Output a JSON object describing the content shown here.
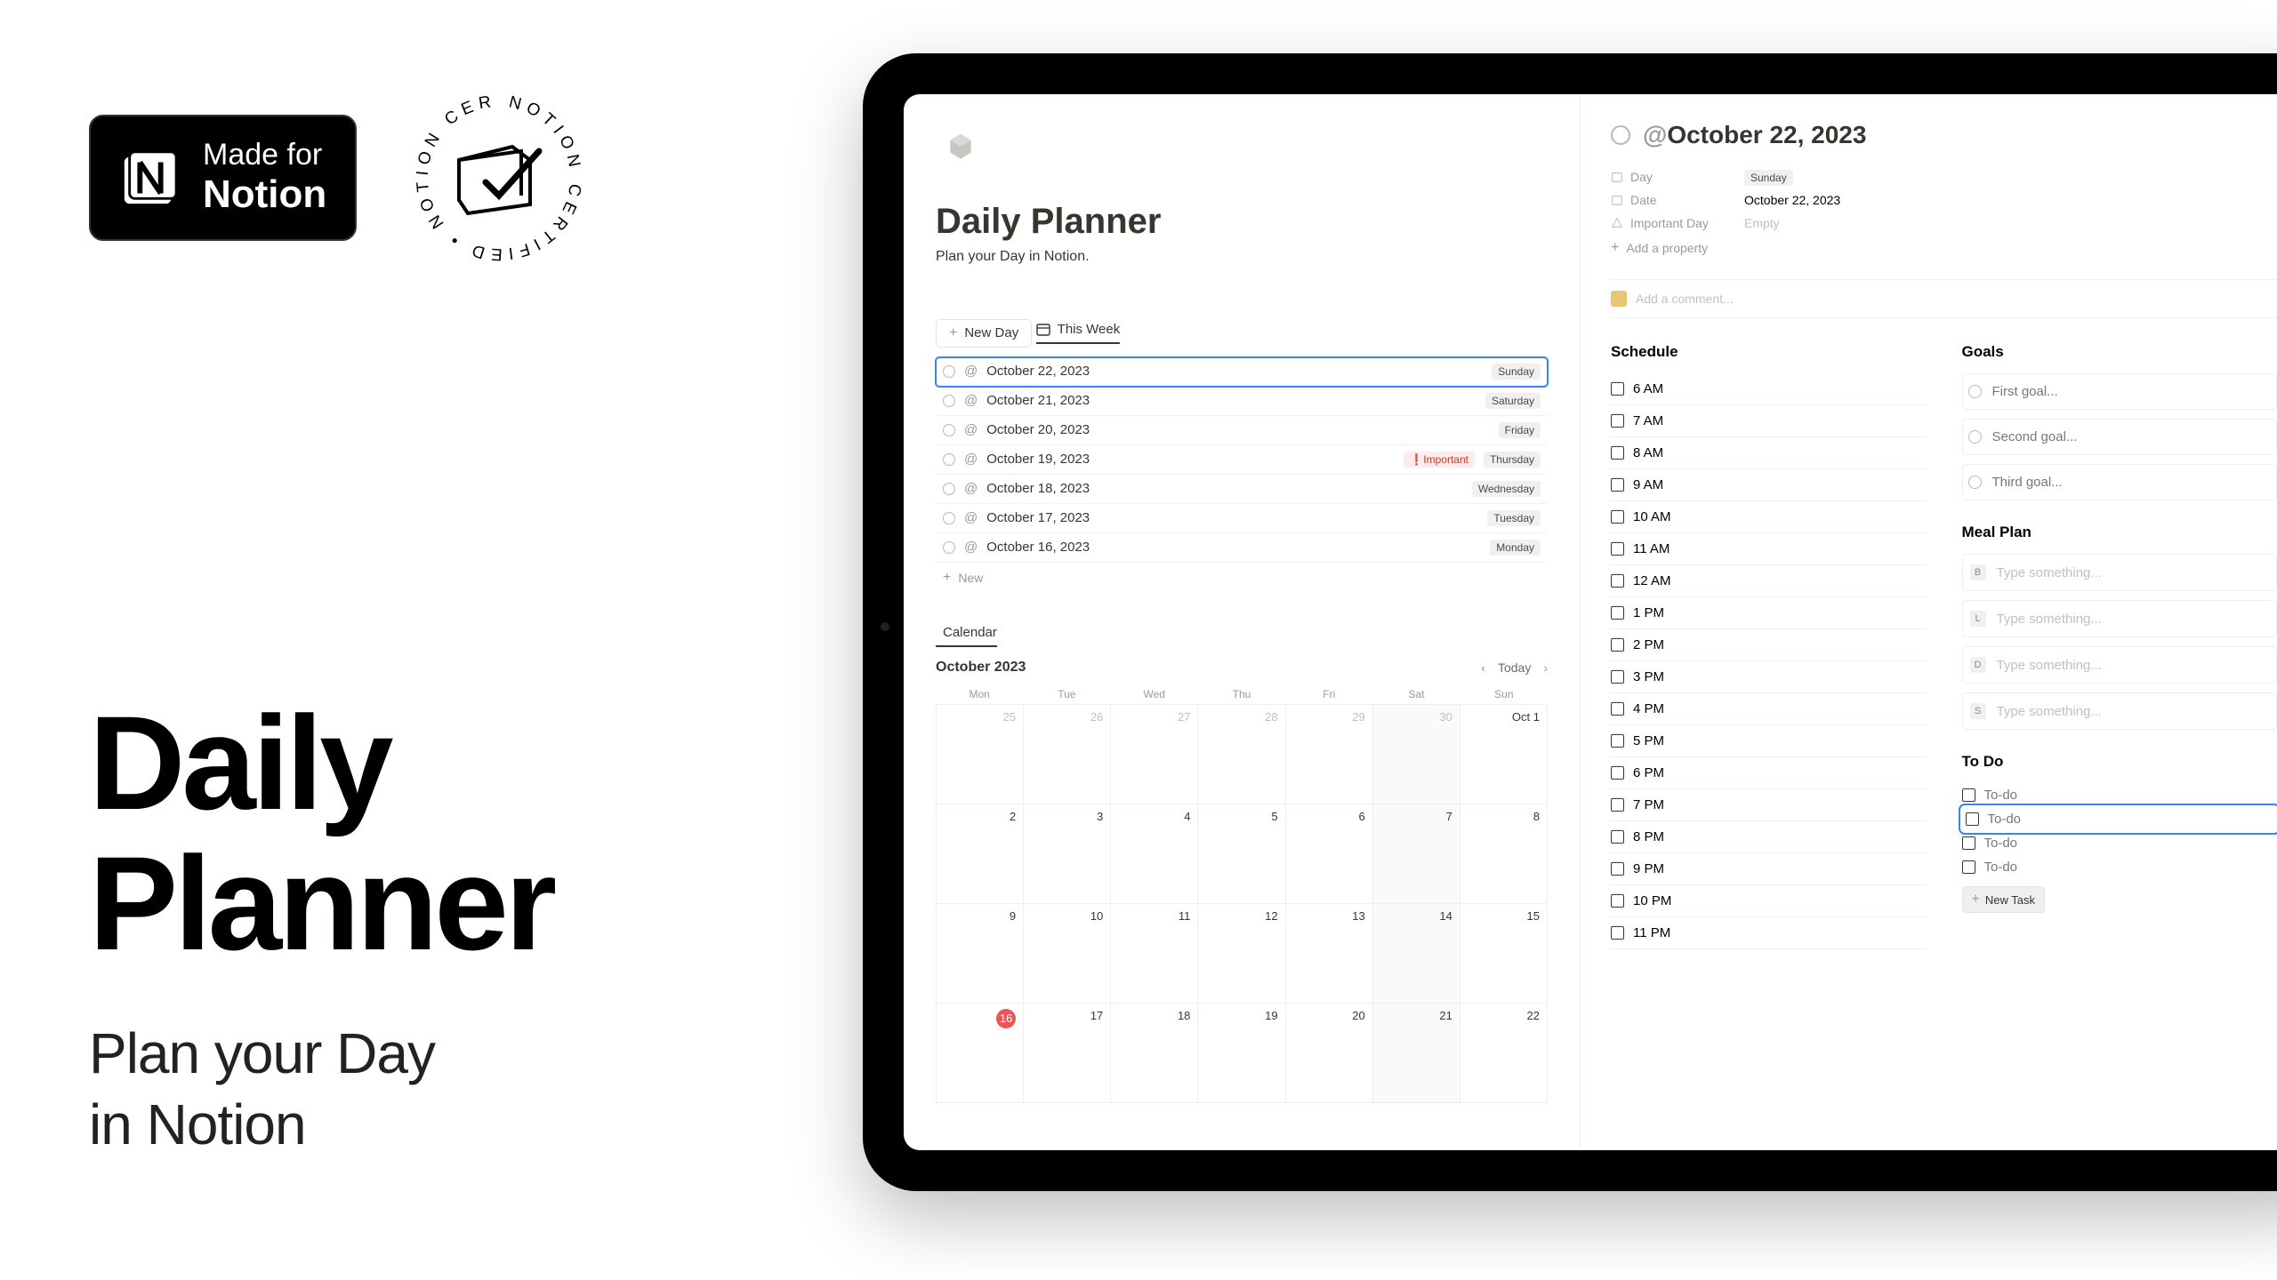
{
  "promo": {
    "badge_line1": "Made for",
    "badge_line2": "Notion",
    "cert_text": "NOTION CERTIFIED",
    "hero_title_l1": "Daily",
    "hero_title_l2": "Planner",
    "hero_sub_l1": "Plan your Day",
    "hero_sub_l2": "in Notion"
  },
  "planner": {
    "title": "Daily Planner",
    "subtitle": "Plan your Day in Notion.",
    "new_day_label": "New Day",
    "this_week_tab": "This Week",
    "new_row_label": "New",
    "week": [
      {
        "date": "October 22, 2023",
        "day_tag": "Sunday",
        "important": false,
        "selected": true
      },
      {
        "date": "October 21, 2023",
        "day_tag": "Saturday",
        "important": false,
        "selected": false
      },
      {
        "date": "October 20, 2023",
        "day_tag": "Friday",
        "important": false,
        "selected": false
      },
      {
        "date": "October 19, 2023",
        "day_tag": "Thursday",
        "important": true,
        "selected": false
      },
      {
        "date": "October 18, 2023",
        "day_tag": "Wednesday",
        "important": false,
        "selected": false
      },
      {
        "date": "October 17, 2023",
        "day_tag": "Tuesday",
        "important": false,
        "selected": false
      },
      {
        "date": "October 16, 2023",
        "day_tag": "Monday",
        "important": false,
        "selected": false
      }
    ],
    "important_tag": "Important",
    "calendar_tab": "Calendar",
    "calendar": {
      "month_label": "October 2023",
      "today_label": "Today",
      "dow": [
        "Mon",
        "Tue",
        "Wed",
        "Thu",
        "Fri",
        "Sat",
        "Sun"
      ],
      "cells": [
        {
          "n": "25",
          "dim": true
        },
        {
          "n": "26",
          "dim": true
        },
        {
          "n": "27",
          "dim": true
        },
        {
          "n": "28",
          "dim": true
        },
        {
          "n": "29",
          "dim": true
        },
        {
          "n": "30",
          "dim": true,
          "hilite": true
        },
        {
          "n": "Oct 1"
        },
        {
          "n": "2"
        },
        {
          "n": "3"
        },
        {
          "n": "4"
        },
        {
          "n": "5"
        },
        {
          "n": "6"
        },
        {
          "n": "7",
          "hilite": true
        },
        {
          "n": "8"
        },
        {
          "n": "9"
        },
        {
          "n": "10"
        },
        {
          "n": "11"
        },
        {
          "n": "12"
        },
        {
          "n": "13"
        },
        {
          "n": "14",
          "hilite": true
        },
        {
          "n": "15"
        },
        {
          "n": "16",
          "red": true
        },
        {
          "n": "17"
        },
        {
          "n": "18"
        },
        {
          "n": "19"
        },
        {
          "n": "20"
        },
        {
          "n": "21",
          "hilite": true
        },
        {
          "n": "22"
        }
      ]
    }
  },
  "detail": {
    "title": "October 22, 2023",
    "props": {
      "day_label": "Day",
      "day_value": "Sunday",
      "date_label": "Date",
      "date_value": "October 22, 2023",
      "important_label": "Important Day",
      "important_value": "Empty",
      "add_property": "Add a property"
    },
    "comment_placeholder": "Add a comment...",
    "schedule_title": "Schedule",
    "schedule": [
      "6 AM",
      "7 AM",
      "8 AM",
      "9 AM",
      "10 AM",
      "11 AM",
      "12 AM",
      "1 PM",
      "2 PM",
      "3 PM",
      "4 PM",
      "5 PM",
      "6 PM",
      "7 PM",
      "8 PM",
      "9 PM",
      "10 PM",
      "11 PM"
    ],
    "goals_title": "Goals",
    "goals": [
      "First goal...",
      "Second goal...",
      "Third goal..."
    ],
    "meal_title": "Meal Plan",
    "meals": [
      {
        "key": "B",
        "ph": "Type something..."
      },
      {
        "key": "L",
        "ph": "Type something..."
      },
      {
        "key": "D",
        "ph": "Type something..."
      },
      {
        "key": "S",
        "ph": "Type something..."
      }
    ],
    "todo_title": "To Do",
    "todos": [
      "To-do",
      "To-do",
      "To-do",
      "To-do"
    ],
    "todo_selected_index": 1,
    "new_task_label": "New Task"
  }
}
